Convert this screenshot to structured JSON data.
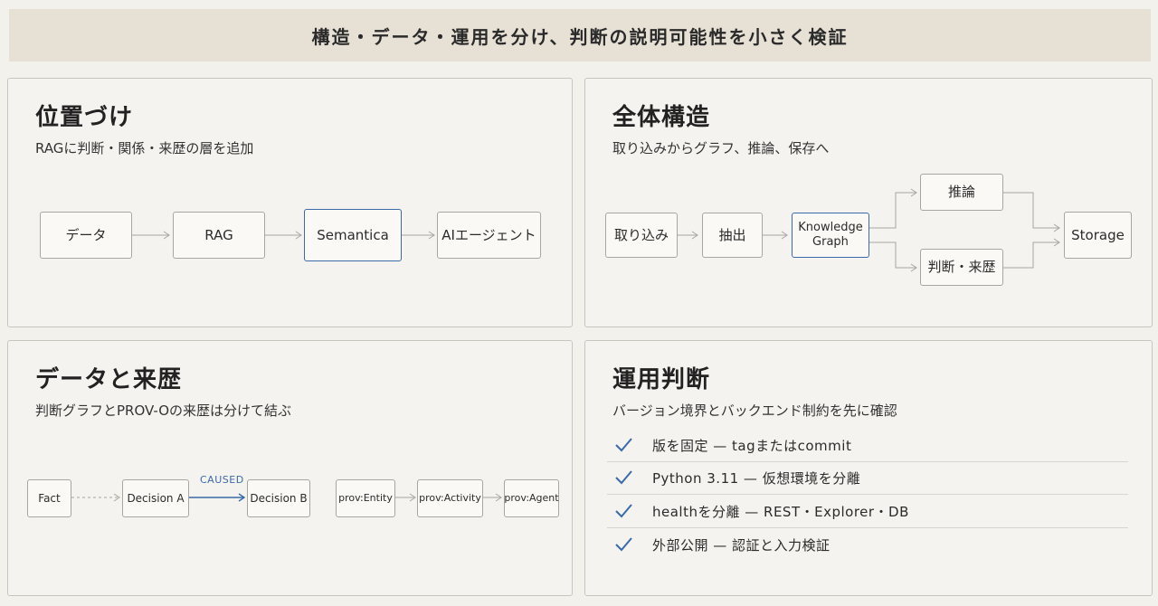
{
  "banner": "構造・データ・運用を分け、判断の説明可能性を小さく検証",
  "positioning": {
    "title": "位置づけ",
    "subtitle": "RAGに判断・関係・来歴の層を追加",
    "nodes": [
      "データ",
      "RAG",
      "Semantica",
      "AIエージェント"
    ]
  },
  "architecture": {
    "title": "全体構造",
    "subtitle": "取り込みからグラフ、推論、保存へ",
    "nodes": {
      "ingest": "取り込み",
      "extract": "抽出",
      "kg": "Knowledge Graph",
      "reasoning": "推論",
      "decision": "判断・来歴",
      "storage": "Storage"
    }
  },
  "provenance": {
    "title": "データと来歴",
    "subtitle": "判断グラフとPROV-Oの来歴は分けて結ぶ",
    "nodes": {
      "fact": "Fact",
      "decision_a": "Decision A",
      "decision_b": "Decision B",
      "entity": "prov:Entity",
      "activity": "prov:Activity",
      "agent": "prov:Agent"
    },
    "edge_label": "CAUSED"
  },
  "operations": {
    "title": "運用判断",
    "subtitle": "バージョン境界とバックエンド制約を先に確認",
    "items": [
      "版を固定 — tagまたはcommit",
      "Python 3.11 — 仮想環境を分離",
      "healthを分離 — REST・Explorer・DB",
      "外部公開 — 認証と入力検証"
    ]
  },
  "colors": {
    "accent": "#3a6aa8",
    "line": "#a9a6a0",
    "banner": "#e6e0d5"
  }
}
